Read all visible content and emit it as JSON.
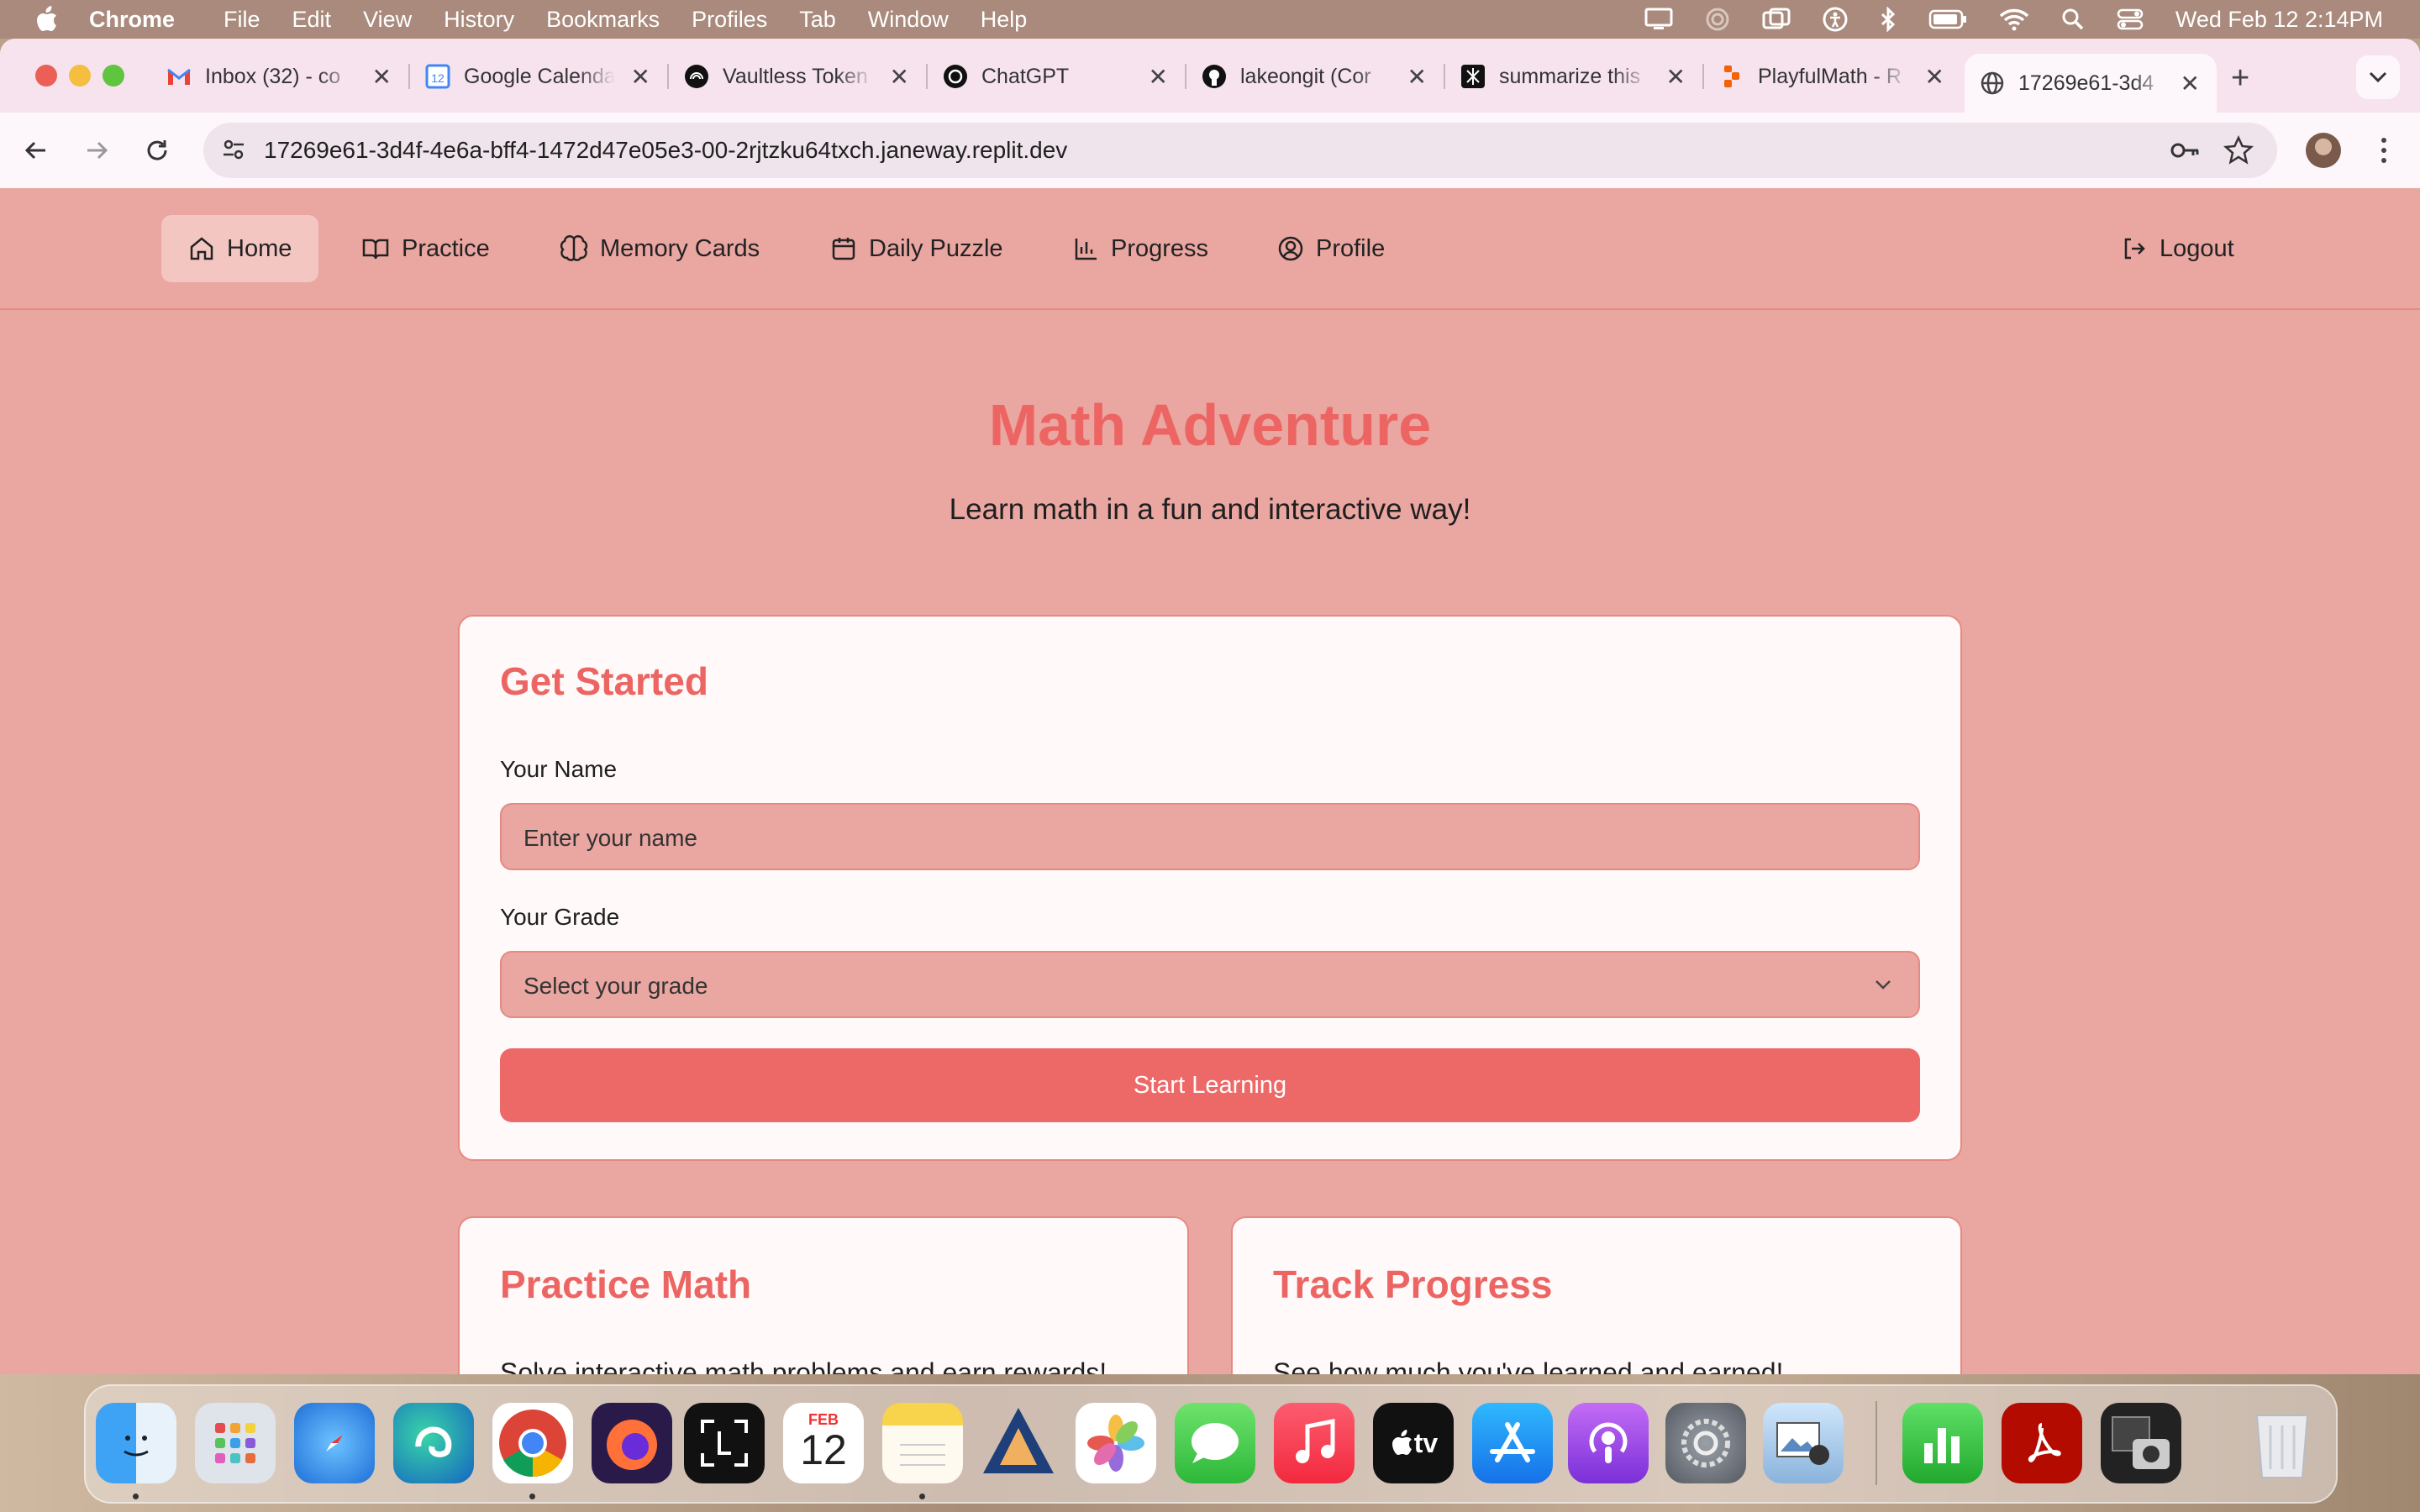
{
  "menubar": {
    "app_name": "Chrome",
    "menus": [
      "File",
      "Edit",
      "View",
      "History",
      "Bookmarks",
      "Profiles",
      "Tab",
      "Window",
      "Help"
    ],
    "clock": "Wed Feb 12  2:14PM"
  },
  "browser": {
    "tabs": [
      {
        "title": "Inbox (32) - co",
        "icon": "gmail-icon"
      },
      {
        "title": "Google Calendar",
        "icon": "calendar-icon"
      },
      {
        "title": "Vaultless Token",
        "icon": "vault-icon"
      },
      {
        "title": "ChatGPT",
        "icon": "chatgpt-icon"
      },
      {
        "title": "lakeongit (Cor",
        "icon": "github-icon"
      },
      {
        "title": "summarize this",
        "icon": "perplexity-icon"
      },
      {
        "title": "PlayfulMath - R",
        "icon": "replit-icon"
      },
      {
        "title": "17269e61-3d4",
        "icon": "globe-icon",
        "active": true
      }
    ],
    "url": "17269e61-3d4f-4e6a-bff4-1472d47e05e3-00-2rjtzku64txch.janeway.replit.dev"
  },
  "app": {
    "nav": {
      "home": "Home",
      "practice": "Practice",
      "memory_cards": "Memory Cards",
      "daily_puzzle": "Daily Puzzle",
      "progress": "Progress",
      "profile": "Profile",
      "logout": "Logout"
    },
    "hero": {
      "title": "Math Adventure",
      "subtitle": "Learn math in a fun and interactive way!"
    },
    "get_started": {
      "title": "Get Started",
      "name_label": "Your Name",
      "name_placeholder": "Enter your name",
      "grade_label": "Your Grade",
      "grade_placeholder": "Select your grade",
      "start_button": "Start Learning"
    },
    "practice_card": {
      "title": "Practice Math",
      "text": "Solve interactive math problems and earn rewards!"
    },
    "progress_card": {
      "title": "Track Progress",
      "text": "See how much you've learned and earned!"
    }
  },
  "dock": {
    "calendar_month": "FEB",
    "calendar_day": "12",
    "apple_tv_label": "tv"
  },
  "colors": {
    "accent": "#ec6563",
    "page_bg": "#eaa6a1",
    "card_bg": "#fffaf9",
    "button": "#ec6967"
  }
}
